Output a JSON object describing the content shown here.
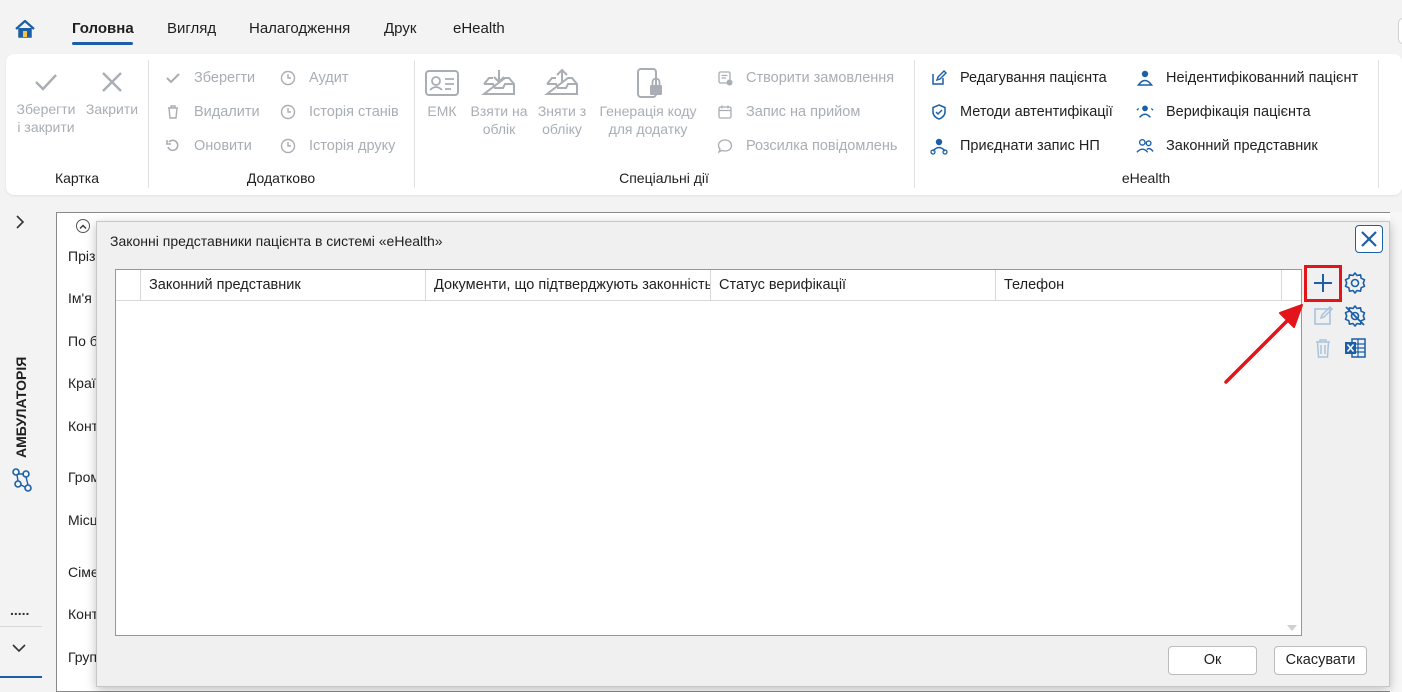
{
  "nav": {
    "tabs": [
      {
        "label": "Головна"
      },
      {
        "label": "Вигляд"
      },
      {
        "label": "Налагодження"
      },
      {
        "label": "Друк"
      },
      {
        "label": "eHealth"
      }
    ]
  },
  "ribbon": {
    "kartka": {
      "label": "Картка",
      "save_close_l1": "Зберегти",
      "save_close_l2": "і закрити",
      "close": "Закрити"
    },
    "dodatkovo": {
      "label": "Додатково",
      "save": "Зберегти",
      "delete": "Видалити",
      "refresh": "Оновити",
      "audit": "Аудит",
      "status_history": "Історія станів",
      "print_history": "Історія друку"
    },
    "special": {
      "label": "Спеціальні дії",
      "emk": "ЕМК",
      "take_l1": "Взяти на",
      "take_l2": "облік",
      "remove_l1": "Зняти з",
      "remove_l2": "обліку",
      "gen_l1": "Генерація коду",
      "gen_l2": "для додатку",
      "create_order": "Створити замовлення",
      "appointment": "Запис на прийом",
      "mailing": "Розсилка повідомлень"
    },
    "ehealth": {
      "label": "eHealth",
      "edit_patient": "Редагування пацієнта",
      "auth_methods": "Методи автентифікації",
      "attach_record": "Приєднати запис НП",
      "unidentified": "Неідентифікованний пацієнт",
      "verification": "Верифікація пацієнта",
      "legal_rep": "Законний представник"
    }
  },
  "sidebar": {
    "vertical_label": "АМБУЛАТОРІЯ",
    "dots": "....."
  },
  "background_form": {
    "labels": [
      "Пріз",
      "Ім'я",
      "По б",
      "Краї",
      "Конт",
      "Гром",
      "Місц",
      "Сіме",
      "Конт",
      "Груп"
    ]
  },
  "dialog": {
    "title": "Законні представники пацієнта в системі «eHealth»",
    "columns": [
      "Законний представник",
      "Документи, що підтверджують законність",
      "Статус верифікації",
      "Телефон"
    ],
    "ok": "Ок",
    "cancel": "Скасувати"
  },
  "colors": {
    "accent": "#1a5fa8",
    "highlight": "#e3151a",
    "disabled": "#a8aeb4"
  }
}
